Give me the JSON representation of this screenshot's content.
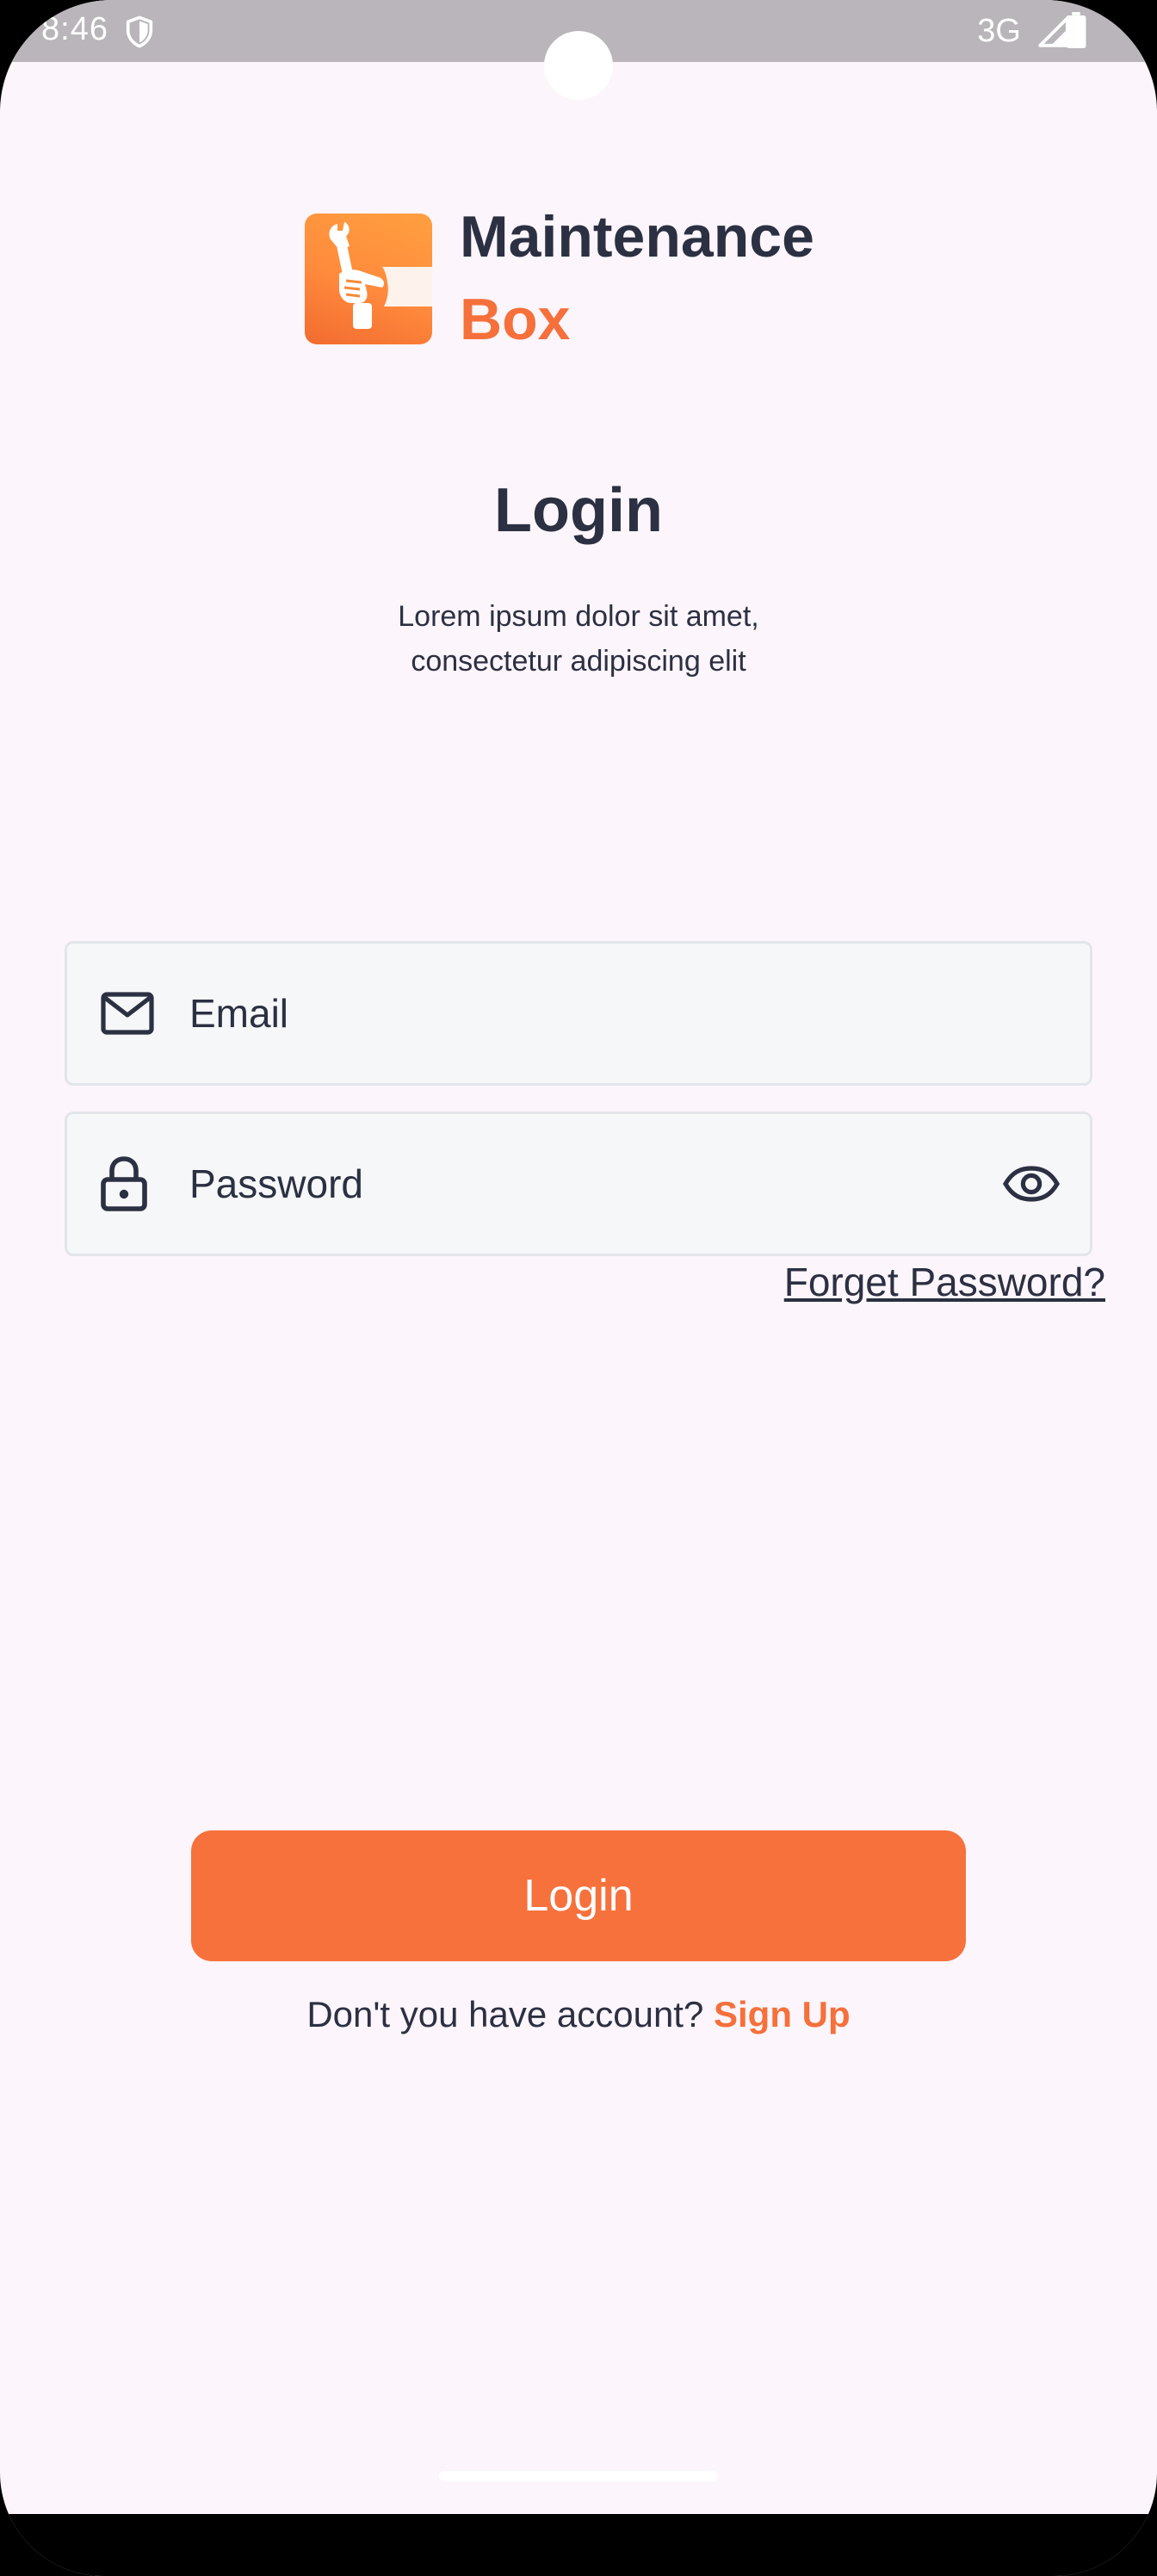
{
  "status_bar": {
    "time": "8:46",
    "network": "3G",
    "icons": [
      "shield-icon",
      "signal-icon",
      "battery-icon"
    ]
  },
  "brand": {
    "name": "Maintenance",
    "sub": "Box",
    "logo_icon": "hand-wrench-icon"
  },
  "login": {
    "title": "Login",
    "subtitle_line1": "Lorem ipsum dolor sit amet,",
    "subtitle_line2": "consectetur adipiscing elit"
  },
  "form": {
    "email_placeholder": "Email",
    "email_value": "",
    "email_icon": "mail-icon",
    "password_placeholder": "Password",
    "password_value": "",
    "password_icon": "lock-icon",
    "visibility_icon": "eye-icon",
    "forgot_label": "Forget Password?"
  },
  "actions": {
    "login_label": "Login",
    "signup_prompt": "Don't you have account?",
    "signup_label": "Sign Up"
  },
  "colors": {
    "accent": "#f7713c",
    "text": "#2b3042",
    "background": "#fcf5fb",
    "field_bg": "#f6f7f9"
  }
}
